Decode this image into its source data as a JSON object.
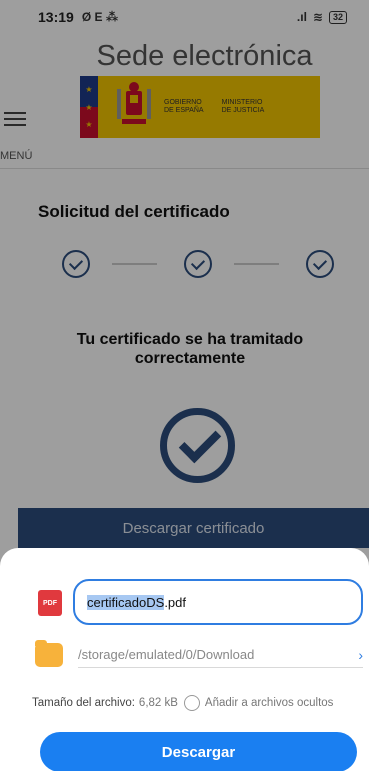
{
  "status_bar": {
    "time": "13:19",
    "icons": "Ø E ⁂",
    "battery": "32"
  },
  "header": {
    "site_title": "Sede electrónica",
    "gov_left": "GOBIERNO\nDE ESPAÑA",
    "gov_right": "MINISTERIO\nDE JUSTICIA",
    "menu_label": "MENÚ"
  },
  "main": {
    "title": "Solicitud del certificado",
    "success_message": "Tu certificado se ha tramitado correctamente",
    "download_cert_label": "Descargar certificado"
  },
  "download_sheet": {
    "file_icon_label": "PDF",
    "filename_selected": "certificadoDS",
    "filename_ext": ".pdf",
    "path": "/storage/emulated/0/Download",
    "size_label": "Tamaño del archivo:",
    "size_value": "6,82 kB",
    "hidden_option": "Añadir a archivos ocultos",
    "download_button": "Descargar"
  },
  "colors": {
    "brand_navy": "#2c4d7c",
    "accent_blue": "#1a7ff1",
    "gov_yellow": "#f3c500"
  }
}
